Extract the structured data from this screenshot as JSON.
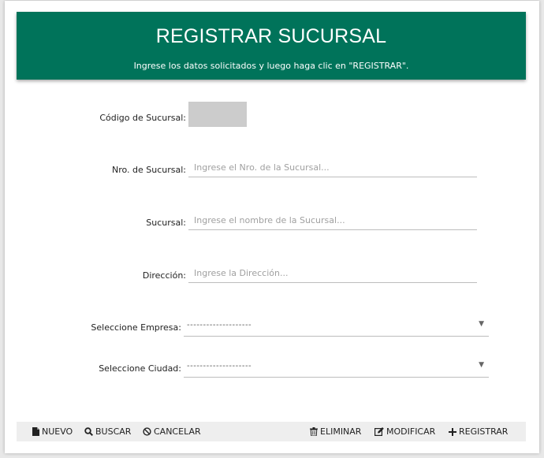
{
  "header": {
    "title": "REGISTRAR SUCURSAL",
    "subtitle": "Ingrese los datos solicitados y luego haga clic en \"REGISTRAR\"."
  },
  "form": {
    "codigo": {
      "label": "Código de Sucursal:",
      "value": ""
    },
    "nro": {
      "label": "Nro. de Sucursal:",
      "placeholder": "Ingrese el Nro. de la Sucursal..."
    },
    "sucursal": {
      "label": "Sucursal:",
      "placeholder": "Ingrese el nombre de la Sucursal..."
    },
    "direccion": {
      "label": "Dirección:",
      "placeholder": "Ingrese la Dirección..."
    },
    "empresa": {
      "label": "Seleccione Empresa:",
      "selected": "--------------------"
    },
    "ciudad": {
      "label": "Seleccione Ciudad:",
      "selected": "--------------------"
    }
  },
  "toolbar": {
    "nuevo": {
      "label": "NUEVO",
      "icon": "file-icon"
    },
    "buscar": {
      "label": "BUSCAR",
      "icon": "search-icon"
    },
    "cancelar": {
      "label": "CANCELAR",
      "icon": "ban-icon"
    },
    "eliminar": {
      "label": "ELIMINAR",
      "icon": "trash-icon"
    },
    "modificar": {
      "label": "MODIFICAR",
      "icon": "edit-icon"
    },
    "registrar": {
      "label": "REGISTRAR",
      "icon": "plus-icon"
    }
  },
  "colors": {
    "header_bg": "#00735a",
    "toolbar_bg": "#eeeeee",
    "codebox_bg": "#cccccc"
  }
}
